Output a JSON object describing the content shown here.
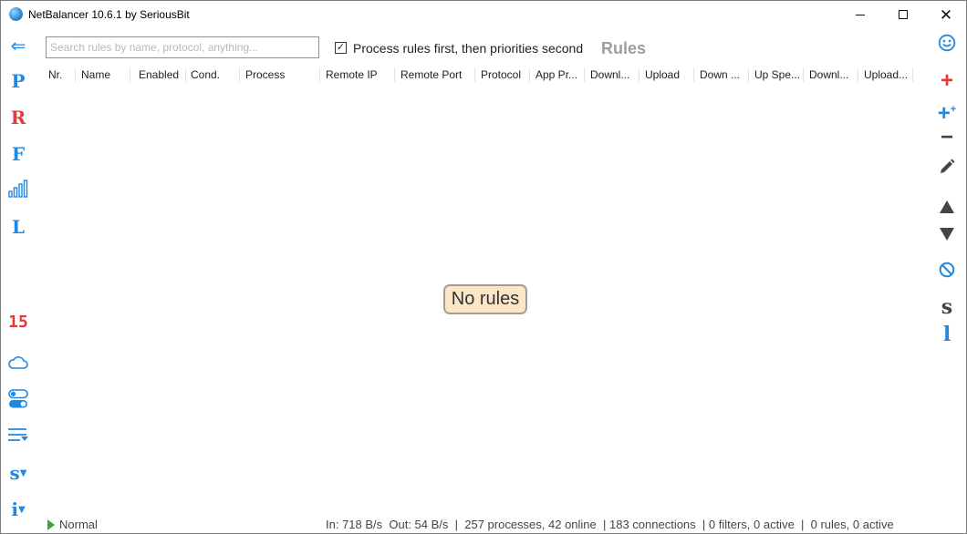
{
  "window": {
    "title": "NetBalancer 10.6.1 by SeriousBit"
  },
  "leftbar": {
    "back": "⇐",
    "p": "P",
    "r": "R",
    "f": "F",
    "l": "L",
    "count": "15",
    "s": "s",
    "i": "i"
  },
  "search": {
    "placeholder": "Search rules by name, protocol, anything...",
    "value": ""
  },
  "process_rules_first": {
    "label": "Process rules first, then priorities second",
    "checked": true,
    "mark": "✓"
  },
  "section_title": "Rules",
  "table": {
    "columns": [
      "Nr.",
      "Name",
      "Enabled",
      "Cond.",
      "Process",
      "Remote IP",
      "Remote Port",
      "Protocol",
      "App Pr...",
      "Downl...",
      "Upload",
      "Down ...",
      "Up Spe...",
      "Downl...",
      "Upload..."
    ],
    "rows": []
  },
  "empty_state": "No rules",
  "rightbar": {
    "add": "+",
    "add_plus": "+",
    "add_plus_sup": "+",
    "remove": "−",
    "s": "s",
    "l": "l"
  },
  "statusbar": {
    "mode": "Normal",
    "stats": "In: 718 B/s  Out: 54 B/s  |  257 processes, 42 online  | 183 connections  | 0 filters, 0 active  |  0 rules, 0 active"
  },
  "colors": {
    "accent_blue": "#1e88e5",
    "accent_red": "#e53935",
    "empty_bg": "#fbe6c8",
    "status_green": "#43a047"
  }
}
